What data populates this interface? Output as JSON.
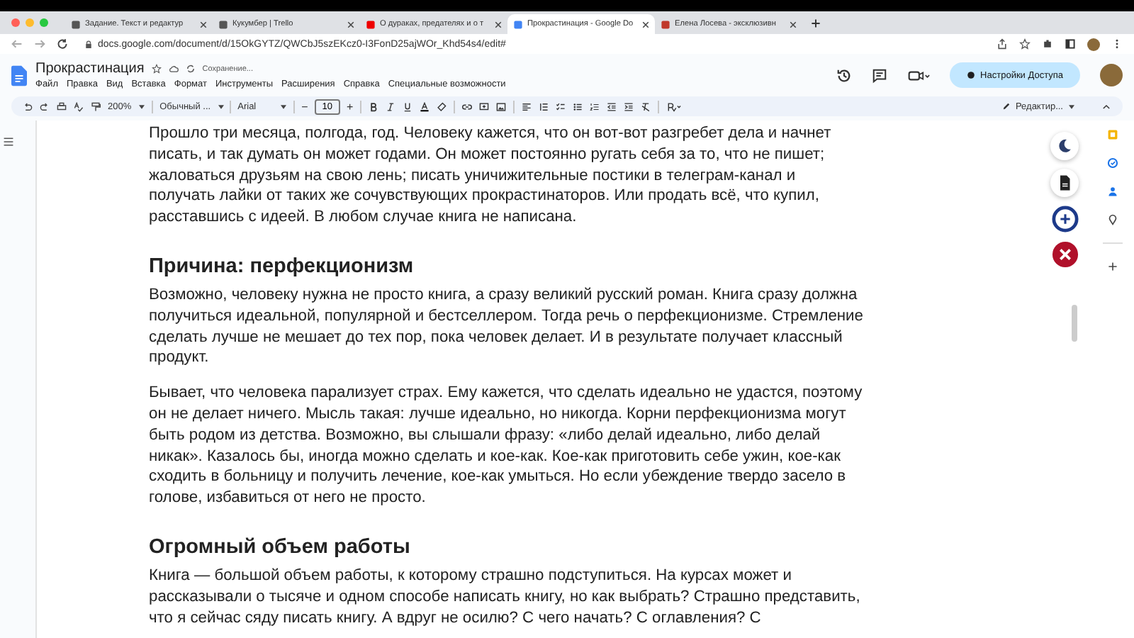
{
  "browser": {
    "tabs": [
      {
        "title": "Задание. Текст и редактур",
        "selected": false
      },
      {
        "title": "Кукумбер | Trello",
        "selected": false
      },
      {
        "title": "О дураках, предателях и о т",
        "selected": false
      },
      {
        "title": "Прокрастинация - Google Do",
        "selected": true
      },
      {
        "title": "Елена Лосева - эксклюзивн",
        "selected": false
      }
    ],
    "url": "docs.google.com/document/d/15OkGYTZ/QWCbJ5szEKcz0-I3FonD25ajWOr_Khd54s4/edit#"
  },
  "doc_header": {
    "title": "Прокрастинация",
    "save_status": "Сохранение...",
    "menu": [
      "Файл",
      "Правка",
      "Вид",
      "Вставка",
      "Формат",
      "Инструменты",
      "Расширения",
      "Справка",
      "Специальные возможности"
    ],
    "share_button": "Настройки Доступа"
  },
  "toolbar": {
    "zoom": "200%",
    "style": "Обычный ...",
    "font": "Arial",
    "minus": "−",
    "font_size": "10",
    "plus": "+",
    "mode": "Редактир..."
  },
  "document": {
    "blocks": [
      {
        "kind": "paragraph",
        "text": "Прошло три месяца, полгода, год. Человеку кажется, что он вот-вот разгребет дела и начнет писать, и так думать он может годами. Он может постоянно ругать себя за то, что не пишет; жаловаться друзьям на свою лень; писать уничижительные постики в телеграм-канал и получать лайки от таких же сочувствующих прокрастинаторов. Или продать всё, что купил, расставшись с идеей. В любом случае книга не написана."
      },
      {
        "kind": "heading",
        "text": "Причина: перфекционизм"
      },
      {
        "kind": "paragraph",
        "text": "Возможно, человеку нужна не просто книга, а сразу великий русский роман. Книга сразу должна получиться идеальной, популярной и бестселлером. Тогда речь о перфекционизме. Стремление сделать лучше не мешает до тех пор, пока человек делает. И в результате получает классный продукт."
      },
      {
        "kind": "paragraph",
        "text": "Бывает, что человека парализует страх. Ему кажется, что сделать идеально не удастся, поэтому он не делает ничего. Мысль такая: лучше идеально, но никогда. Корни перфекционизма могут быть родом из детства. Возможно, вы слышали фразу: «либо делай идеально, либо делай никак». Казалось бы, иногда можно сделать и кое-как. Кое-как приготовить себе ужин, кое-как сходить в больницу и получить лечение, кое-как умыться. Но если убеждение твердо засело в голове, избавиться от него не просто."
      },
      {
        "kind": "heading",
        "text": "Огромный объем работы"
      },
      {
        "kind": "paragraph",
        "text": "Книга — большой объем работы, к которому страшно подступиться. На курсах может и рассказывали о тысяче и одном способе написать книгу, но как выбрать? Страшно представить, что я сейчас сяду писать книгу. А вдруг не осилю? С чего начать? С оглавления? С"
      }
    ]
  }
}
